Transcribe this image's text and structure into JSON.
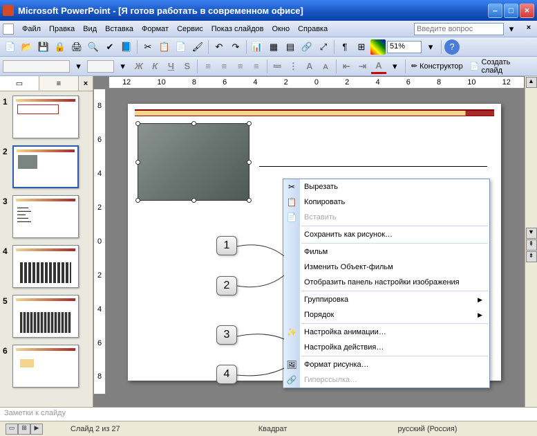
{
  "window": {
    "title": "Microsoft PowerPoint - [Я готов работать в современном офисе]"
  },
  "menu": {
    "file": "Файл",
    "edit": "Правка",
    "view": "Вид",
    "insert": "Вставка",
    "format": "Формат",
    "tools": "Сервис",
    "slideshow": "Показ слайдов",
    "window": "Окно",
    "help": "Справка",
    "askbox": "Введите вопрос"
  },
  "toolbar": {
    "zoom": "51%",
    "designer": "Конструктор",
    "newslide": "Создать слайд"
  },
  "ruler_h": [
    "12",
    "10",
    "8",
    "6",
    "4",
    "2",
    "0",
    "2",
    "4",
    "6",
    "8",
    "10",
    "12"
  ],
  "ruler_v": [
    "8",
    "6",
    "4",
    "2",
    "0",
    "2",
    "4",
    "6",
    "8"
  ],
  "thumbs": [
    {
      "num": "1"
    },
    {
      "num": "2"
    },
    {
      "num": "3"
    },
    {
      "num": "4"
    },
    {
      "num": "5"
    },
    {
      "num": "6"
    }
  ],
  "context": {
    "cut": "Вырезать",
    "copy": "Копировать",
    "paste": "Вставить",
    "save_as_pic": "Сохранить как рисунок…",
    "movie": "Фильм",
    "edit_object": "Изменить Объект-фильм",
    "show_pic_toolbar": "Отобразить панель настройки изображения",
    "grouping": "Группировка",
    "order": "Порядок",
    "custom_anim": "Настройка анимации…",
    "action_settings": "Настройка действия…",
    "format_pic": "Формат рисунка…",
    "hyperlink": "Гиперссылка…"
  },
  "callouts": {
    "c1": "1",
    "c2": "2",
    "c3": "3",
    "c4": "4"
  },
  "notes": "Заметки к слайду",
  "status": {
    "slide": "Слайд 2 из 27",
    "shape": "Квадрат",
    "lang": "русский (Россия)"
  }
}
